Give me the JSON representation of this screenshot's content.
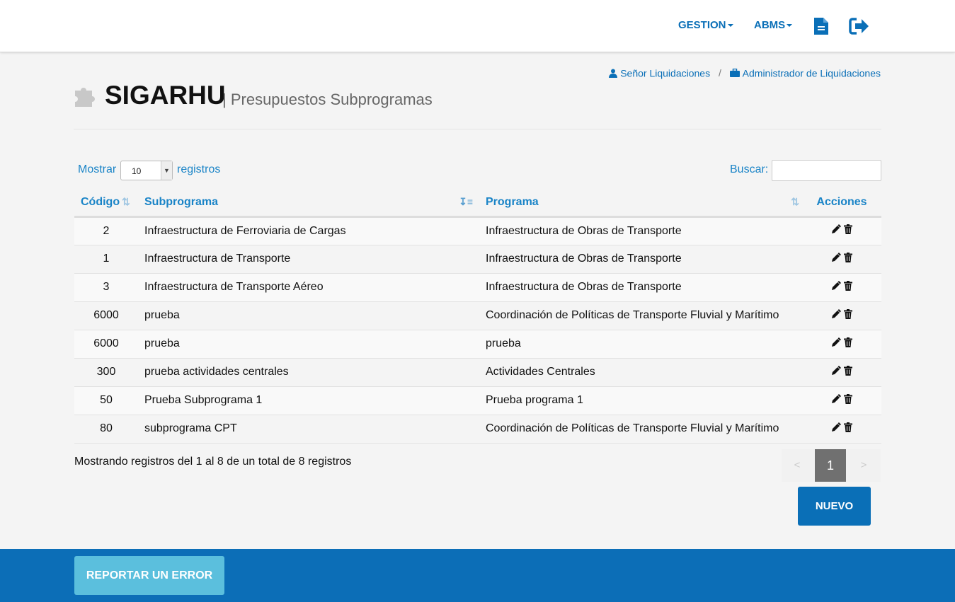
{
  "nav": {
    "gestion": "GESTION",
    "abms": "ABMS",
    "doc_icon": "document-icon",
    "logout_icon": "logout-icon"
  },
  "breadcrumb": {
    "user": "Señor Liquidaciones",
    "separator": "/",
    "role": "Administrador de Liquidaciones"
  },
  "header": {
    "title": "SIGARHU",
    "subtitle": "| Presupuestos Subprogramas",
    "icon": "puzzle-icon"
  },
  "controls": {
    "show_label": "Mostrar",
    "show_value": "10",
    "records_label": "registros",
    "search_label": "Buscar:",
    "search_value": ""
  },
  "table": {
    "columns": [
      "Código",
      "Subprograma",
      "Programa",
      "Acciones"
    ],
    "rows": [
      {
        "codigo": "2",
        "subprograma": "Infraestructura de Ferroviaria de Cargas",
        "programa": "Infraestructura de Obras de Transporte"
      },
      {
        "codigo": "1",
        "subprograma": "Infraestructura de Transporte",
        "programa": "Infraestructura de Obras de Transporte"
      },
      {
        "codigo": "3",
        "subprograma": "Infraestructura de Transporte Aéreo",
        "programa": "Infraestructura de Obras de Transporte"
      },
      {
        "codigo": "6000",
        "subprograma": "prueba",
        "programa": "Coordinación de Políticas de Transporte Fluvial y Marítimo"
      },
      {
        "codigo": "6000",
        "subprograma": "prueba",
        "programa": "prueba"
      },
      {
        "codigo": "300",
        "subprograma": "prueba actividades centrales",
        "programa": "Actividades Centrales"
      },
      {
        "codigo": "50",
        "subprograma": "Prueba Subprograma 1",
        "programa": "Prueba programa 1"
      },
      {
        "codigo": "80",
        "subprograma": "subprograma CPT",
        "programa": "Coordinación de Políticas de Transporte Fluvial y Marítimo"
      }
    ]
  },
  "info": "Mostrando registros del 1 al 8 de un total de 8 registros",
  "pagination": {
    "prev": "<",
    "current": "1",
    "next": ">"
  },
  "buttons": {
    "new": "NUEVO",
    "report": "REPORTAR UN ERROR"
  },
  "colors": {
    "brand": "#0a6fb7",
    "footer": "#0c6eb7",
    "report": "#5bbfdd",
    "link": "#1a84c7"
  }
}
